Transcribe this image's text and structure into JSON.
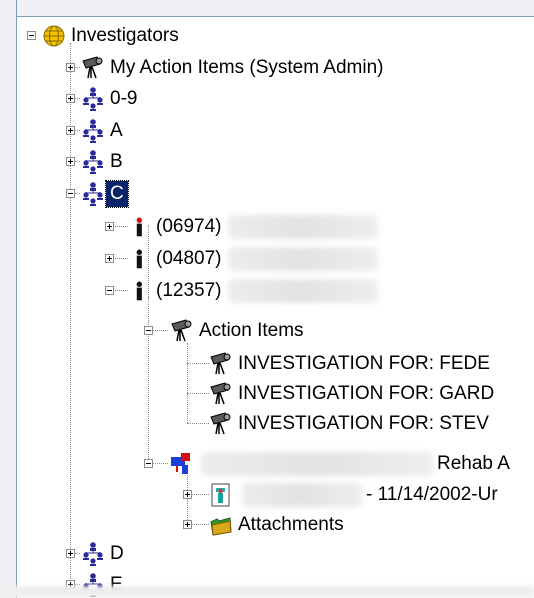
{
  "tree": {
    "root": {
      "label": "Investigators",
      "icon": "globe-icon"
    },
    "my_action_items": {
      "label": "My Action Items (System Admin)",
      "icon": "telescope-icon"
    },
    "groups": [
      {
        "label": "0-9",
        "icon": "org-chart-icon"
      },
      {
        "label": "A",
        "icon": "org-chart-icon"
      },
      {
        "label": "B",
        "icon": "org-chart-icon"
      },
      {
        "label": "C",
        "icon": "org-chart-icon",
        "selected": true
      }
    ],
    "investigators": [
      {
        "label": "(06974)",
        "icon": "person-red-icon"
      },
      {
        "label": "(04807)",
        "icon": "person-icon"
      },
      {
        "label": "(12357)",
        "icon": "person-icon"
      }
    ],
    "action_items": {
      "label": "Action Items",
      "icon": "telescope-icon",
      "items": [
        {
          "label": "INVESTIGATION FOR: FEDE",
          "icon": "telescope-icon"
        },
        {
          "label": "INVESTIGATION FOR: GARD",
          "icon": "telescope-icon"
        },
        {
          "label": "INVESTIGATION FOR: STEV",
          "icon": "telescope-icon"
        }
      ]
    },
    "case": {
      "label": "Rehab A",
      "icon": "network-icon",
      "children": [
        {
          "label": "- 11/14/2002-Ur",
          "icon": "document-icon"
        },
        {
          "label": "Attachments",
          "icon": "folder-green-icon"
        }
      ]
    },
    "more_groups": [
      {
        "label": "D",
        "icon": "org-chart-icon"
      },
      {
        "label": "E",
        "icon": "org-chart-icon"
      }
    ]
  },
  "colors": {
    "selection": "#0a246a",
    "tree_lines": "#8c8c8c",
    "org_chart": "#2a2a9a"
  }
}
